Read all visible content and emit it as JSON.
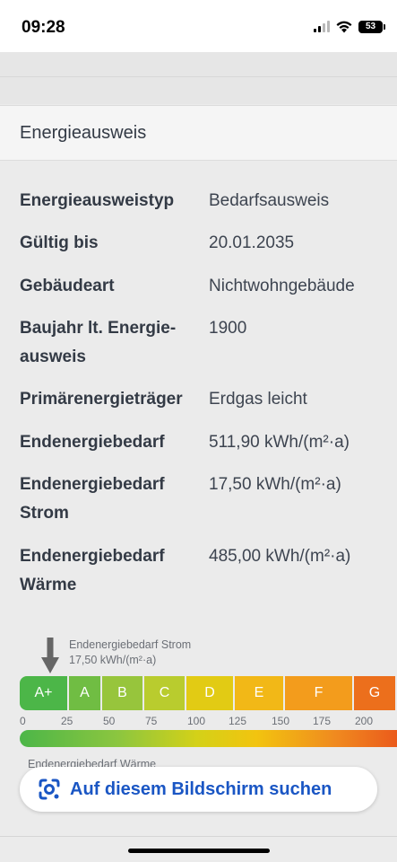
{
  "status_bar": {
    "time": "09:28",
    "battery": "53",
    "icons": [
      "signal-icon",
      "wifi-icon",
      "battery-icon"
    ]
  },
  "section": {
    "title": "Energieausweis"
  },
  "details": [
    {
      "label": "Energieausweistyp",
      "value": "Bedarfsausweis"
    },
    {
      "label": "Gültig bis",
      "value": "20.01.2035"
    },
    {
      "label": "Gebäudeart",
      "value": "Nichtwohngebäude"
    },
    {
      "label": "Baujahr lt. Energie- ausweis",
      "value": "1900"
    },
    {
      "label": "Primärenergieträger",
      "value": "Erdgas leicht"
    },
    {
      "label": "Endenergiebedarf",
      "value": "511,90 kWh/(m²·a)"
    },
    {
      "label": "Endenergiebedarf Strom",
      "value": "17,50 kWh/(m²·a)"
    },
    {
      "label": "Endenergiebedarf Wärme",
      "value": "485,00 kWh/(m²·a)"
    }
  ],
  "scale": {
    "caption_title": "Endenergiebedarf Strom",
    "caption_value": "17,50 kWh/(m²·a)",
    "marker_value": 17.5,
    "classes": [
      {
        "label": "A+",
        "color": "#4cb648"
      },
      {
        "label": "A",
        "color": "#70bd43"
      },
      {
        "label": "B",
        "color": "#97c53c"
      },
      {
        "label": "C",
        "color": "#b9cc2e"
      },
      {
        "label": "D",
        "color": "#e2cb14"
      },
      {
        "label": "E",
        "color": "#f2b817"
      },
      {
        "label": "F",
        "color": "#f39c1c"
      },
      {
        "label": "G",
        "color": "#ec6f1c"
      }
    ],
    "ticks": [
      "0",
      "25",
      "50",
      "75",
      "100",
      "125",
      "150",
      "175",
      "200"
    ],
    "cut_caption": "Endenergiebedarf Wärme"
  },
  "search_button": {
    "label": "Auf diesem Bildschirm suchen",
    "icon": "google-lens-icon",
    "color": "#1a56c4"
  }
}
